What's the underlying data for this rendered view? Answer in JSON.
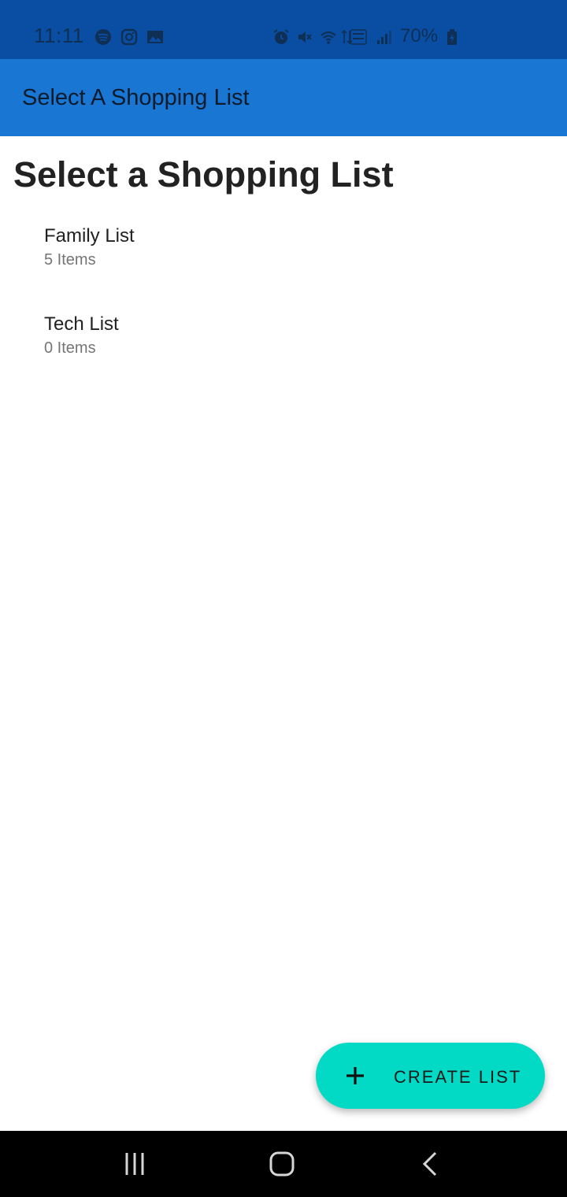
{
  "status_bar": {
    "time": "11:11",
    "battery_percent": "70%",
    "left_icons": [
      "spotify-icon",
      "instagram-icon",
      "gallery-icon"
    ],
    "right_icons": [
      "alarm-icon",
      "mute-icon",
      "wifi-icon",
      "data-arrows-icon",
      "volte-icon",
      "signal-icon",
      "battery-charging-icon"
    ]
  },
  "app_bar": {
    "title": "Select A Shopping List",
    "background": "#1976d2"
  },
  "main": {
    "heading": "Select a Shopping List",
    "lists": [
      {
        "name": "Family List",
        "count": "5 Items"
      },
      {
        "name": "Tech List",
        "count": "0 Items"
      }
    ]
  },
  "fab": {
    "icon": "plus-icon",
    "label": "CREATE LIST",
    "color": "#03dac5"
  },
  "nav_bar": {
    "buttons": [
      "recent-apps-icon",
      "home-icon",
      "back-icon"
    ]
  }
}
